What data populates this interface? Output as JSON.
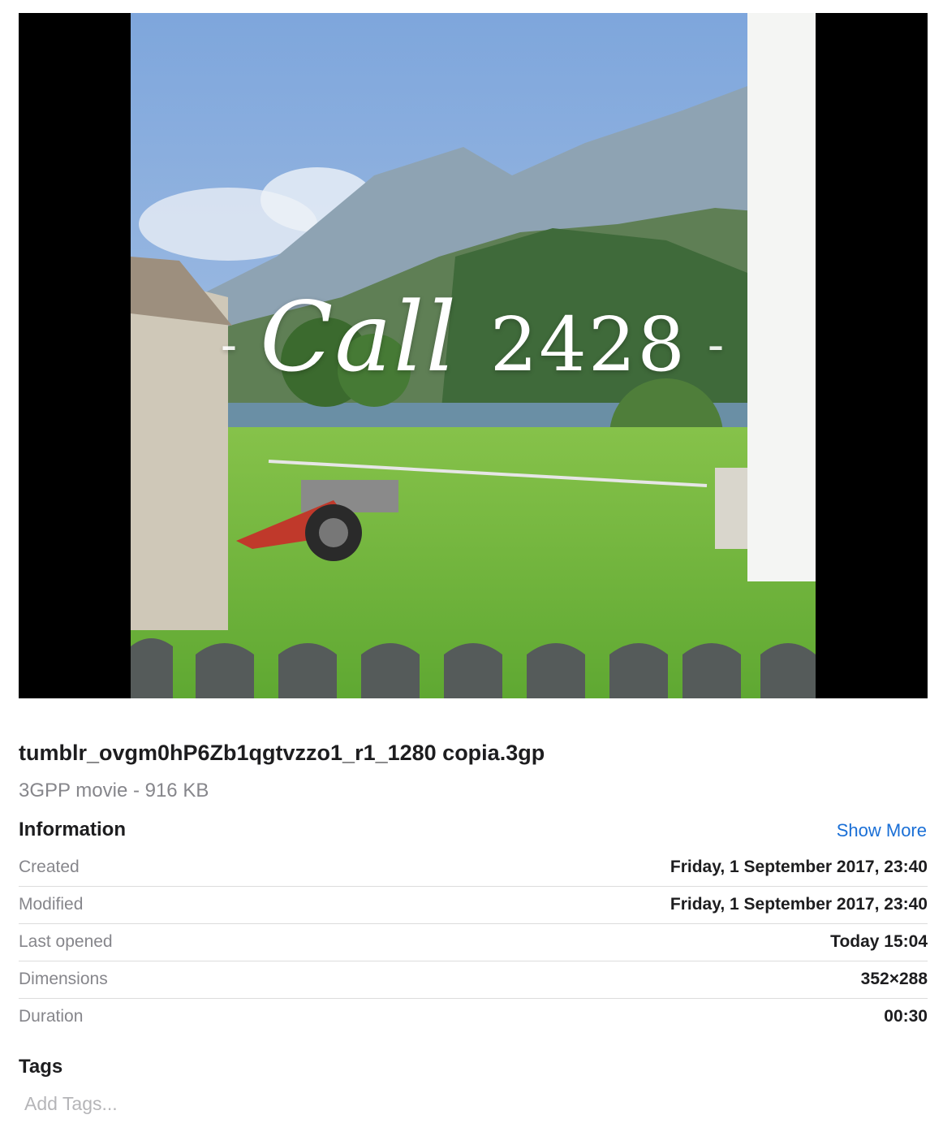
{
  "preview": {
    "overlay_text_left": "-",
    "overlay_text_word": "Call",
    "overlay_text_number": "2428",
    "overlay_text_right": "-"
  },
  "file": {
    "name": "tumblr_ovgm0hP6Zb1qgtvzzo1_r1_1280 copia.3gp",
    "kind": "3GPP movie - 916 KB"
  },
  "information": {
    "title": "Information",
    "show_more": "Show More",
    "rows": [
      {
        "label": "Created",
        "value": "Friday, 1 September 2017, 23:40"
      },
      {
        "label": "Modified",
        "value": "Friday, 1 September 2017, 23:40"
      },
      {
        "label": "Last opened",
        "value": "Today 15:04"
      },
      {
        "label": "Dimensions",
        "value": "352×288"
      },
      {
        "label": "Duration",
        "value": "00:30"
      }
    ]
  },
  "tags": {
    "title": "Tags",
    "placeholder": "Add Tags..."
  },
  "colors": {
    "link": "#1a6fd6",
    "secondary_text": "#86868b",
    "preview_background": "#000000"
  }
}
